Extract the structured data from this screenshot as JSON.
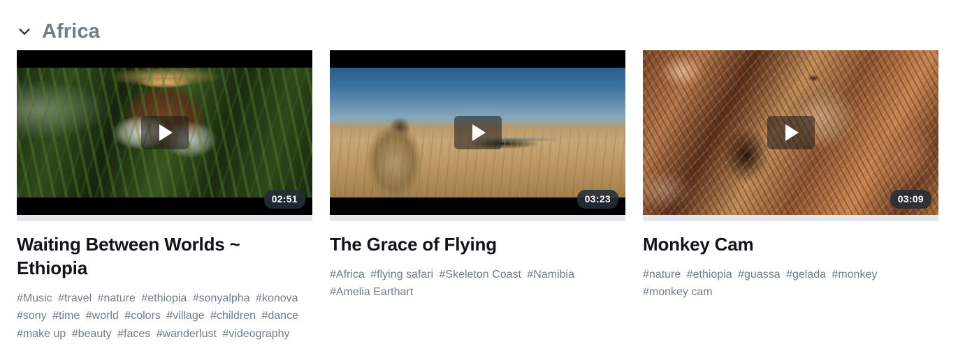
{
  "section": {
    "title": "Africa",
    "collapse_icon": "chevron-down-icon",
    "expanded": true
  },
  "videos": [
    {
      "title": "Waiting Between Worlds ~ Ethiopia",
      "duration": "02:51",
      "play_icon": "play-icon",
      "thumb_class": "thumb-1",
      "letterboxed": true,
      "tags": [
        "#Music",
        "#travel",
        "#nature",
        "#ethiopia",
        "#sonyalpha",
        "#konova",
        "#sony",
        "#time",
        "#world",
        "#colors",
        "#village",
        "#children",
        "#dance",
        "#make up",
        "#beauty",
        "#faces",
        "#wanderlust",
        "#videography"
      ]
    },
    {
      "title": "The Grace of Flying",
      "duration": "03:23",
      "play_icon": "play-icon",
      "thumb_class": "thumb-2",
      "letterboxed": true,
      "tags": [
        "#Africa",
        "#flying safari",
        "#Skeleton Coast",
        "#Namibia",
        "#Amelia Earthart"
      ]
    },
    {
      "title": "Monkey Cam",
      "duration": "03:09",
      "play_icon": "play-icon",
      "thumb_class": "thumb-3",
      "letterboxed": false,
      "tags": [
        "#nature",
        "#ethiopia",
        "#guassa",
        "#gelada",
        "#monkey",
        "#monkey cam"
      ]
    }
  ],
  "colors": {
    "page_background": "#ffffff",
    "section_title": "#6f7c8b",
    "card_title": "#111418",
    "tag_text": "#6f7c8b",
    "progress_track": "#e4e8ec",
    "badge_background": "#262e38",
    "badge_text": "#ffffff"
  }
}
